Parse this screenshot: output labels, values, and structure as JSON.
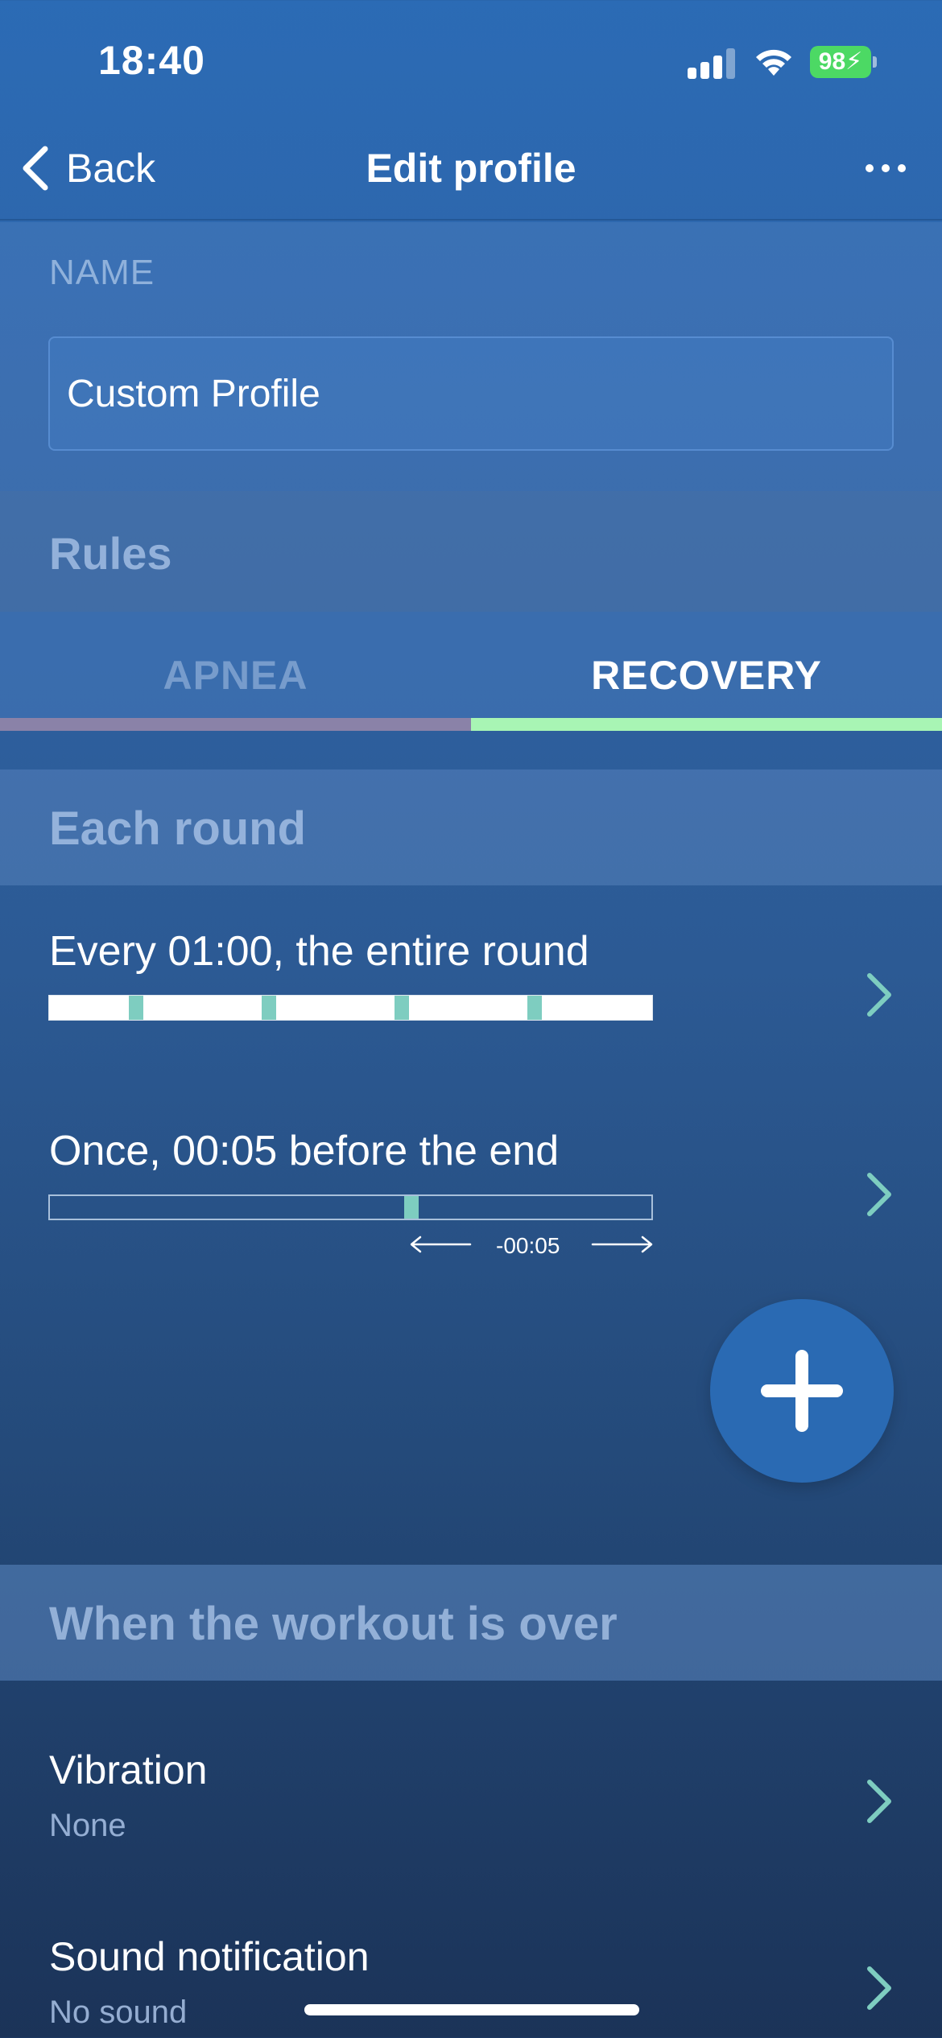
{
  "status_bar": {
    "time": "18:40",
    "battery": "98"
  },
  "nav": {
    "back_label": "Back",
    "title": "Edit profile"
  },
  "name_section": {
    "label": "NAME",
    "value": "Custom Profile"
  },
  "rules": {
    "title": "Rules"
  },
  "tabs": [
    {
      "label": "APNEA",
      "selected": false
    },
    {
      "label": "RECOVERY",
      "selected": true
    }
  ],
  "each_round": {
    "title": "Each round",
    "rules": [
      {
        "text": "Every 01:00, the entire round"
      },
      {
        "text": "Once, 00:05 before the end",
        "offset_label": "-00:05"
      }
    ]
  },
  "workout_over": {
    "title": "When the workout is over",
    "settings": [
      {
        "title": "Vibration",
        "value": "None"
      },
      {
        "title": "Sound notification",
        "value": "No sound"
      }
    ]
  },
  "colors": {
    "accent_tab": "#a8f5b4",
    "tick": "#7ecdc0",
    "chevron": "#7ecdc0",
    "fab": "#2a6ab3",
    "battery": "#4cd964"
  }
}
